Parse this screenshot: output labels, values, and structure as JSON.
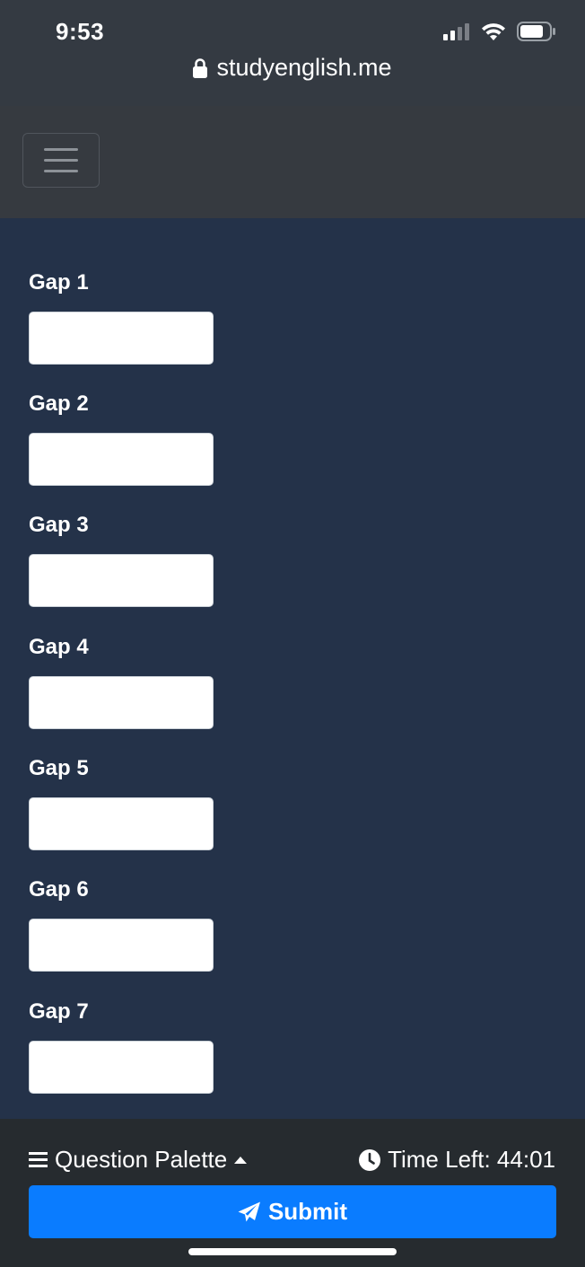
{
  "status_bar": {
    "time": "9:53",
    "icons": [
      "cellular-signal-icon",
      "wifi-icon",
      "battery-icon"
    ]
  },
  "browser": {
    "url": "studyenglish.me",
    "lock_icon": "lock-icon"
  },
  "navbar": {
    "toggler_icon": "hamburger-menu-icon"
  },
  "gaps": [
    {
      "label": "Gap 1",
      "value": ""
    },
    {
      "label": "Gap 2",
      "value": ""
    },
    {
      "label": "Gap 3",
      "value": ""
    },
    {
      "label": "Gap 4",
      "value": ""
    },
    {
      "label": "Gap 5",
      "value": ""
    },
    {
      "label": "Gap 6",
      "value": ""
    },
    {
      "label": "Gap 7",
      "value": ""
    }
  ],
  "footer": {
    "palette_label": "Question Palette",
    "palette_icon": "list-icon",
    "timer_label": "Time Left: 44:01",
    "timer_icon": "clock-icon",
    "submit_label": "Submit",
    "submit_icon": "paper-plane-icon"
  },
  "colors": {
    "background": "#243249",
    "navbar": "#363a40",
    "footer": "#262b2f",
    "submit": "#0a7cff"
  }
}
